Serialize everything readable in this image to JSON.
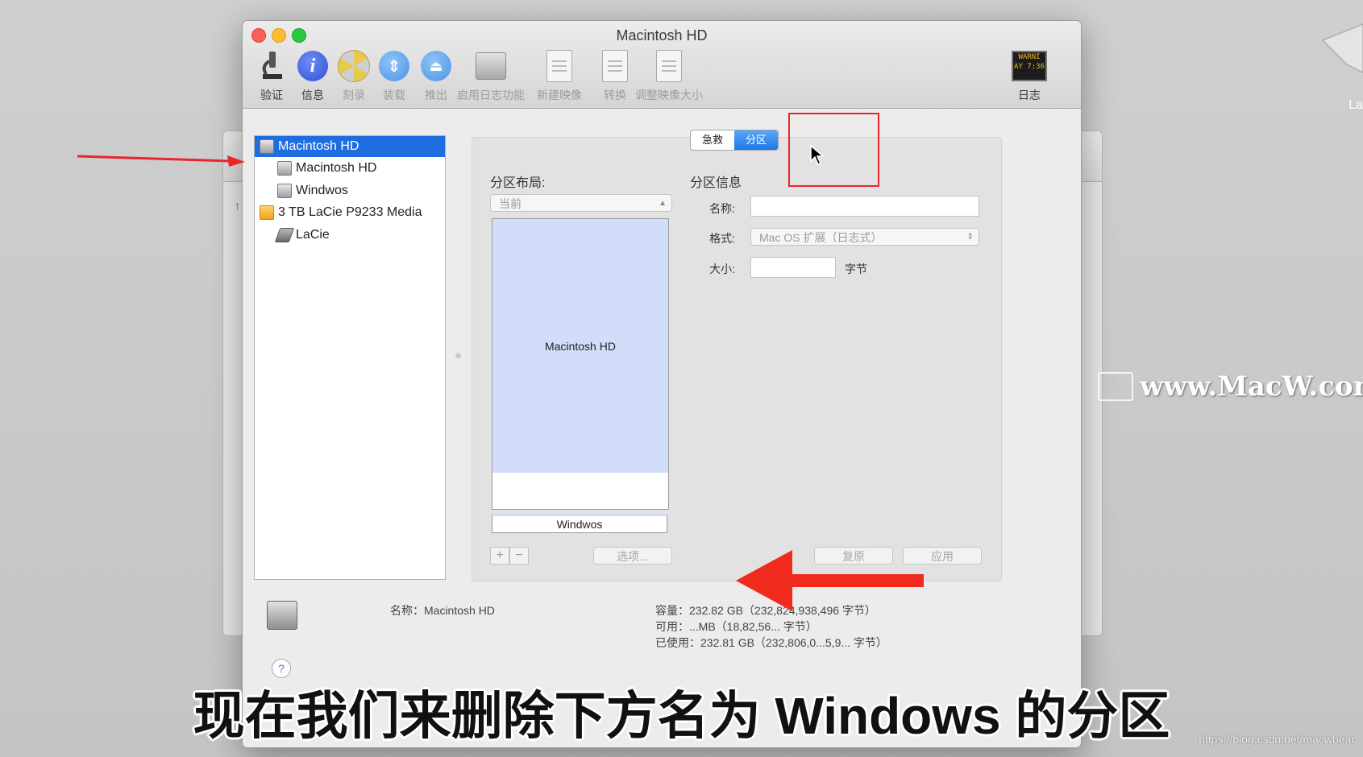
{
  "window": {
    "title": "Macintosh HD"
  },
  "toolbar": {
    "verify": "验证",
    "info": "信息",
    "burn": "刻录",
    "mount": "装载",
    "eject": "推出",
    "journal": "启用日志功能",
    "new_image": "新建映像",
    "convert": "转换",
    "resize": "调整映像大小",
    "log": "日志",
    "log_icon_text": "WARNI AY 7:36"
  },
  "sidebar": {
    "items": [
      {
        "label": "Macintosh HD",
        "icon": "internal-disk-icon",
        "selected": true
      },
      {
        "label": "Macintosh HD",
        "icon": "volume-icon"
      },
      {
        "label": "Windwos",
        "icon": "volume-icon"
      },
      {
        "label": "3 TB LaCie P9233 Media",
        "icon": "external-disk-icon"
      },
      {
        "label": "LaCie",
        "icon": "external-volume-icon"
      }
    ]
  },
  "tabs": {
    "first_aid": "急救",
    "partition": "分区"
  },
  "partition": {
    "layout_label": "分区布局:",
    "layout_value": "当前",
    "info_label": "分区信息",
    "name_label": "名称:",
    "format_label": "格式:",
    "format_value": "Mac OS 扩展（日志式）",
    "size_label": "大小:",
    "size_unit": "字节",
    "partitions": [
      {
        "label": "Macintosh HD"
      },
      {
        "label": "Windwos"
      }
    ],
    "options_button": "选项...",
    "revert_button": "复原",
    "apply_button": "应用",
    "add_symbol": "+",
    "remove_symbol": "−"
  },
  "bottom_info": {
    "name": "名称：Macintosh HD",
    "capacity": "容量：232.82 GB（232,824,938,496 字节）",
    "available": "可用：...MB（18,82,56... 字节）",
    "used": "已使用：232.81 GB（232,806,0...5,9... 字节）",
    "help": "?"
  },
  "caption": "现在我们来删除下方名为 Windows 的分区",
  "watermark": "www.MacW.com",
  "source_credit": "https://blog.csdn.net/macwbear",
  "lacie_label": "La",
  "colors": {
    "selection": "#1f6ee0",
    "partition_fill": "#d2ddf9",
    "annotation": "#e8262b"
  }
}
